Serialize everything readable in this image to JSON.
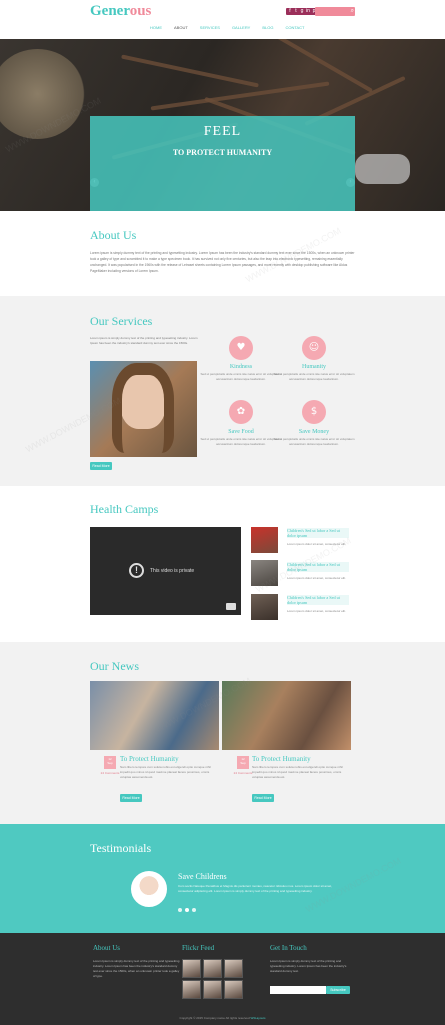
{
  "header": {
    "logo_part1": "Gener",
    "logo_part2": "ous",
    "social": [
      "f",
      "t",
      "g",
      "in",
      "p"
    ],
    "search_placeholder": "",
    "nav": [
      "HOME",
      "ABOUT",
      "SERVICES",
      "GALLERY",
      "BLOG",
      "CONTACT"
    ]
  },
  "hero": {
    "title": "FEEL",
    "subtitle": "TO PROTECT HUMANITY",
    "prev": "‹",
    "next": "›"
  },
  "about": {
    "title": "About Us",
    "paragraph": "Lorem ipsum is simply dummy text of the printing and typesetting industry. Lorem Ipsum has been the industry's standard dummy text ever since the 1500s, when an unknown printer took a galley of type and scrambled it to make a type specimen book. It has survived not only five centuries, but also the leap into electronic typesetting, remaining essentially unchanged. It was popularised in the 1960s with the release of Letraset sheets containing Lorem Ipsum passages, and more recently with desktop publishing software like Aldus PageMaker including versions of Lorem Ipsum."
  },
  "services": {
    "title": "Our Services",
    "intro": "Lorem ipsum is simply dummy text of the printing and typesetting industry. Lorem Ipsum has been the industry's standard dummy text ever since the 1500s.",
    "read_more": "Read More",
    "items": [
      {
        "icon": "♥",
        "title": "Kindness",
        "text": "Sed ut perspiciatis unde omnis iste natus error sit voluptatem accusantium doloremque laudantium."
      },
      {
        "icon": "☺",
        "title": "Humanity",
        "text": "Sed ut perspiciatis unde omnis iste natus error sit voluptatem accusantium doloremque laudantium."
      },
      {
        "icon": "✿",
        "title": "Save Food",
        "text": "Sed ut perspiciatis unde omnis iste natus error sit voluptatem accusantium doloremque laudantium."
      },
      {
        "icon": "$",
        "title": "Save Money",
        "text": "Sed ut perspiciatis unde omnis iste natus error sit voluptatem accusantium doloremque laudantium."
      }
    ]
  },
  "camps": {
    "title": "Health Camps",
    "video_message": "This video is private",
    "items": [
      {
        "title": "Children's Sed ut labor a Sed ut dolor ipsum",
        "text": "Lorem ipsum dolor sit amet, consectetur elit."
      },
      {
        "title": "Children's Sed ut labor a Sed ut dolor ipsum",
        "text": "Lorem ipsum dolor sit amet, consectetur elit."
      },
      {
        "title": "Children's Sed ut labor a Sed ut dolor ipsum",
        "text": "Lorem ipsum dolor sit amet, consectetur elit."
      }
    ]
  },
  "news": {
    "title": "Our News",
    "read_more": "Read More",
    "items": [
      {
        "day": "12",
        "month": "Sep",
        "title": "To Protect Humanity",
        "meta": "24 Comments",
        "text": "Nam libero tempore cum soluta nobis est eligendi optio cumque nihil impedit quo minus id quod maxime placeat facere possimus, omnis voluptas assumenda est."
      },
      {
        "day": "12",
        "month": "Sep",
        "title": "To Protect Humanity",
        "meta": "24 Comments",
        "text": "Nam libero tempore cum soluta nobis est eligendi optio cumque nihil impedit quo minus id quod maxime placeat facere possimus, omnis voluptas assumenda est."
      }
    ]
  },
  "testimonials": {
    "title": "Testimonials",
    "name": "Save Childrens",
    "text": "Cum sociis Natoque Penatibus et Magnis dis parturient montes, nascetur ridiculus mus. Lorem ipsum dolor sit amet, consectetur adipiscing elit. Lorem Ipsum is simply dummy text of the printing and typesetting industry."
  },
  "footer": {
    "about_title": "About Us",
    "about_text": "Lorem Ipsum is simply dummy text of the printing and typesetting industry. Lorem Ipsum has been the industry's standard dummy text ever since the 1500s, when an unknown printer took a galley of type.",
    "flickr_title": "Flickr Feed",
    "contact_title": "Get In Touch",
    "contact_text": "Lorem Ipsum is simply dummy text of the printing and typesetting industry. Lorem Ipsum has been the industry's standard dummy text.",
    "newsletter_placeholder": "",
    "subscribe": "Subscribe",
    "copyright": "Copyright © 2015 Company name All rights reserved",
    "credit": "W3Layouts"
  },
  "watermark": "WWW.DOWNDEMO.COM",
  "colors": {
    "accent": "#46c8c0",
    "pink": "#f5a9b2",
    "footer_bg": "#2e2e2e",
    "testimonial_bg": "#4fc9c1"
  }
}
